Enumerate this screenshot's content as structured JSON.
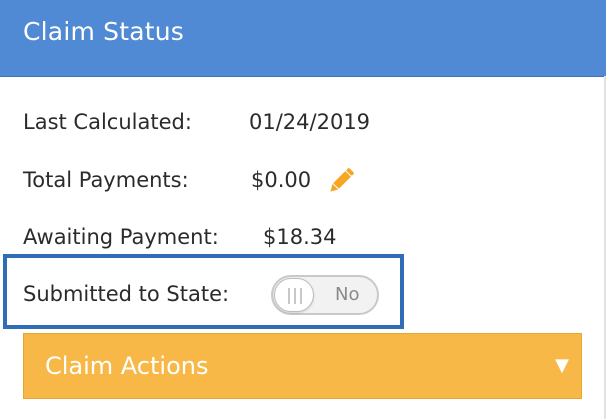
{
  "panel": {
    "title": "Claim Status"
  },
  "fields": {
    "last_calculated": {
      "label": "Last Calculated:",
      "value": "01/24/2019"
    },
    "total_payments": {
      "label": "Total Payments:",
      "value": "$0.00",
      "edit_icon": "pencil-icon"
    },
    "awaiting_payment": {
      "label": "Awaiting Payment:",
      "value": "$18.34"
    },
    "submitted_to_state": {
      "label": "Submitted to State:",
      "toggle_state": "No",
      "toggle_on": false
    }
  },
  "actions": {
    "label": "Claim Actions",
    "caret": "▼"
  },
  "colors": {
    "header": "#5089d4",
    "actions": "#f7b847",
    "highlight": "#2f6db8",
    "pencil": "#f5a623"
  }
}
